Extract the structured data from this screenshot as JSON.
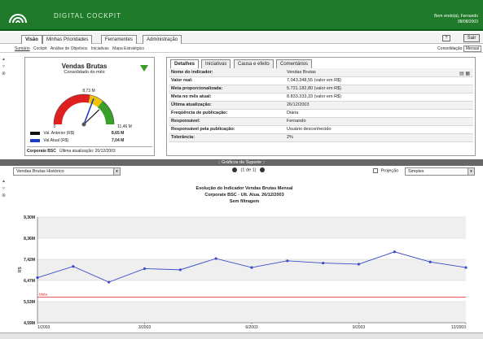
{
  "header": {
    "app_title": "DIGITAL COCKPIT",
    "welcome": "Bem vindo(a), Fernando",
    "date": "08/08/2003"
  },
  "menu": {
    "tabs": [
      "Visão",
      "Minhas Prioridades",
      "Ferramentes",
      "Administração"
    ],
    "help": "?",
    "logout": "Sair"
  },
  "subnav": {
    "links": [
      "Sumário",
      "Cockpit",
      "Análise de Objetivos",
      "Iniciativas",
      "Mapa Estratégico"
    ],
    "right_label": "Consolidação",
    "right_value": "Mensal"
  },
  "gauge": {
    "title": "Vendas Brutas",
    "subtitle": "Consolidado do mês",
    "min_label": "0",
    "max_label": "11,46 M",
    "value_label": "8,73 M",
    "min": 0,
    "max": 11.46,
    "current": 7.04,
    "previous": 8.65,
    "zones": [
      {
        "to": 6.5,
        "color": "#e02020"
      },
      {
        "to": 8.2,
        "color": "#f2c400"
      },
      {
        "to": 11.46,
        "color": "#3aa02a"
      }
    ],
    "legend": [
      {
        "label": "Val. Anterior (R$)",
        "value": "8,65 M",
        "color": "#111111"
      },
      {
        "label": "Val.Atual (R$)",
        "value": "7,04 M",
        "color": "#1a3fbf"
      }
    ],
    "footer_left": "Corporate BSC",
    "footer_right": "Última atualização: 26/12/2003"
  },
  "details": {
    "tabs": [
      "Detalhes",
      "Iniciativas",
      "Causa e efeito",
      "Comentários"
    ],
    "rows": [
      {
        "k": "Nome do indicador:",
        "v": "Vendas Brutas"
      },
      {
        "k": "Valor real:",
        "v": "7.043.348,55 (valor em R$)"
      },
      {
        "k": "Meta proporcionalizada:",
        "v": "5.731.182,80 (valor em R$)"
      },
      {
        "k": "Meta no mês atual:",
        "v": "8.833.333,33 (valor em R$)"
      },
      {
        "k": "Última atualização:",
        "v": "26/12/2003"
      },
      {
        "k": "Freqüência de publicação:",
        "v": "Diária"
      },
      {
        "k": "Responsável:",
        "v": "Fernando"
      },
      {
        "k": "Responsável pela publicação:",
        "v": "Usuário desconhecido"
      },
      {
        "k": "Tolerância:",
        "v": "2%"
      }
    ]
  },
  "support": {
    "bar_title": ":: Gráficos de Suporte ::",
    "selected_chart": "Vendas Brutas Histórico",
    "pager": "(1 de 1)",
    "projection_label": "Projeção",
    "chart_type": "Simples"
  },
  "chart_data": {
    "type": "line",
    "title": "Evolução do Indicador Vendas Brutas Mensal",
    "subtitle": "Corporate BSC - Ult. Atua. 26/12/2003",
    "filter": "Sem filtragem",
    "ylabel": "R$",
    "ylim": [
      4.59,
      9.3
    ],
    "yticks": [
      "9,30M",
      "8,36M",
      "7,42M",
      "6,47M",
      "5,53M",
      "4,59M"
    ],
    "xticks": [
      "1/2003",
      "3/2003",
      "6/2003",
      "9/2003",
      "12/2003"
    ],
    "x": [
      "1/2003",
      "2/2003",
      "3/2003",
      "4/2003",
      "5/2003",
      "6/2003",
      "7/2003",
      "8/2003",
      "9/2003",
      "10/2003",
      "11/2003",
      "12/2003"
    ],
    "series": [
      {
        "values": [
          6.6,
          7.1,
          6.4,
          7.0,
          6.95,
          7.45,
          7.05,
          7.35,
          7.25,
          7.2,
          7.75,
          7.3,
          7.05
        ],
        "color": "#3a4cc8"
      }
    ],
    "target": {
      "label": "Meta",
      "value": 5.73,
      "color": "#e02020"
    },
    "grid": true,
    "bands": true
  }
}
